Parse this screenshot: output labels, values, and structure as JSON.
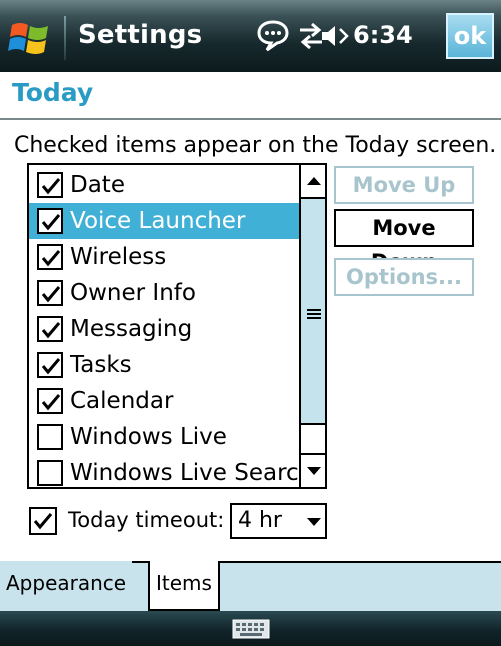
{
  "titlebar": {
    "app_title": "Settings",
    "time": "6:34",
    "ok_label": "ok",
    "icons": [
      "windows-start-icon",
      "notification-bubble-icon",
      "connectivity-arrows-icon",
      "volume-icon"
    ]
  },
  "page": {
    "title": "Today",
    "instruction": "Checked items appear on the Today screen."
  },
  "items": [
    {
      "label": "Date",
      "checked": true,
      "selected": false
    },
    {
      "label": "Voice Launcher",
      "checked": true,
      "selected": true
    },
    {
      "label": "Wireless",
      "checked": true,
      "selected": false
    },
    {
      "label": "Owner Info",
      "checked": true,
      "selected": false
    },
    {
      "label": "Messaging",
      "checked": true,
      "selected": false
    },
    {
      "label": "Tasks",
      "checked": true,
      "selected": false
    },
    {
      "label": "Calendar",
      "checked": true,
      "selected": false
    },
    {
      "label": "Windows Live",
      "checked": false,
      "selected": false
    },
    {
      "label": "Windows Live Search",
      "checked": false,
      "selected": false
    }
  ],
  "buttons": {
    "move_up": "Move Up",
    "move_down": "Move Down",
    "options": "Options..."
  },
  "timeout": {
    "checked": true,
    "label": "Today timeout:",
    "value": "4 hr"
  },
  "tabs": [
    {
      "label": "Appearance",
      "active": false
    },
    {
      "label": "Items",
      "active": true
    }
  ],
  "colors": {
    "accent": "#2a9bc4",
    "selection": "#41b0d6",
    "panel": "#c9e3ec"
  }
}
